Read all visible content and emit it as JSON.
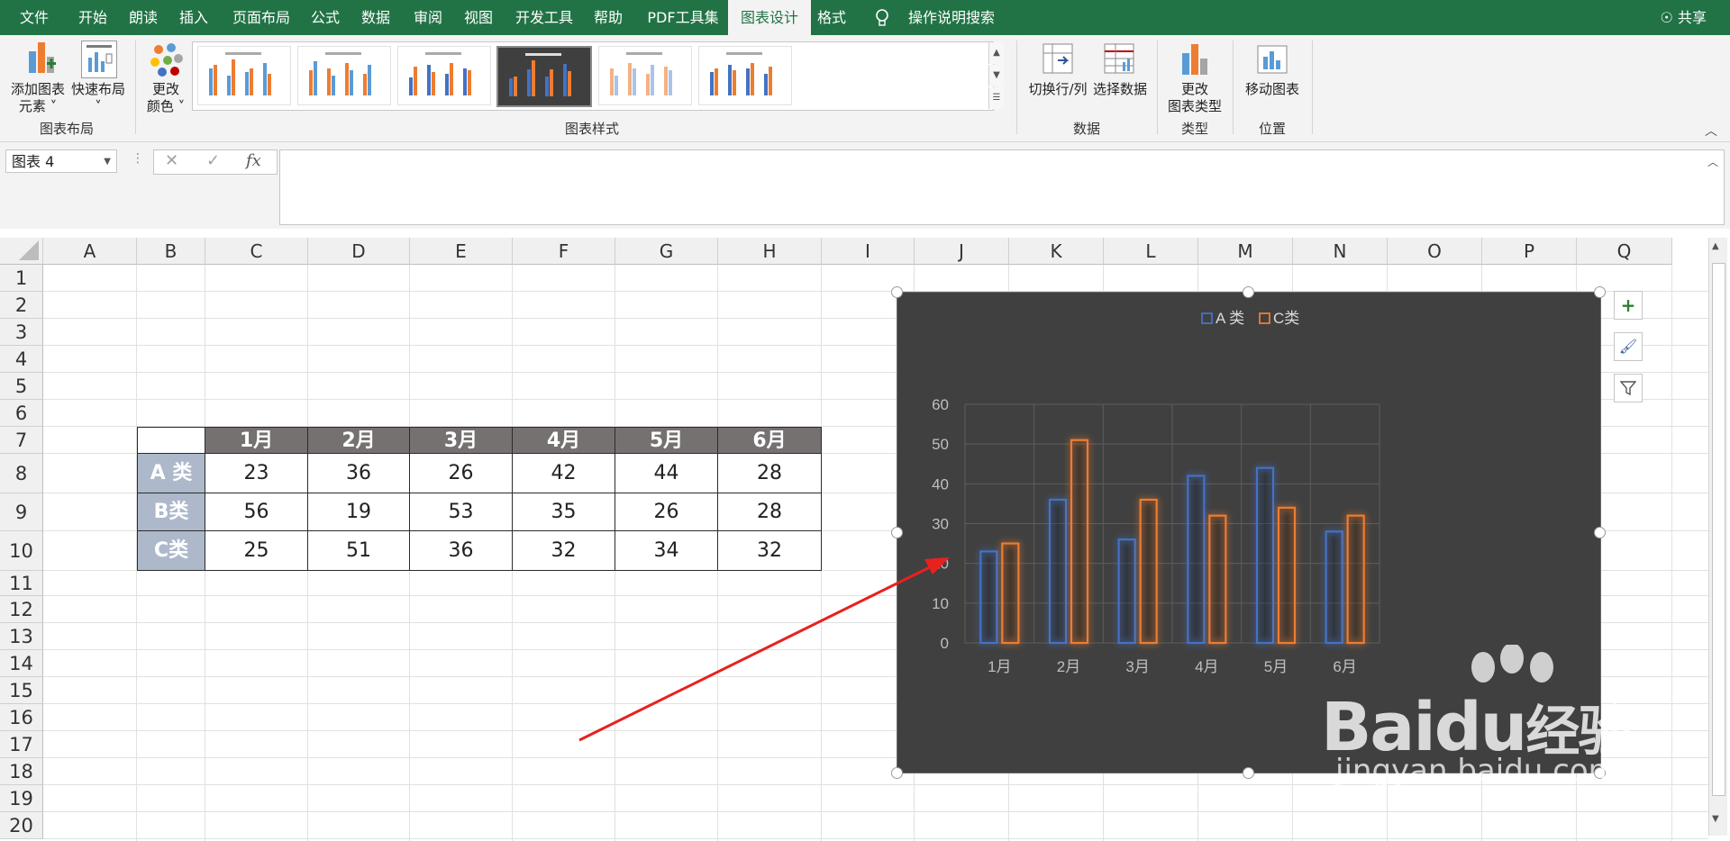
{
  "tabs": [
    "文件",
    "开始",
    "朗读",
    "插入",
    "页面布局",
    "公式",
    "数据",
    "审阅",
    "视图",
    "开发工具",
    "帮助",
    "PDF工具集",
    "图表设计",
    "格式"
  ],
  "tell_me": "操作说明搜索",
  "share": "共享",
  "ribbon": {
    "add_element_line1": "添加图表",
    "add_element_line2": "元素",
    "quick_layout": "快速布局",
    "change_colors_line1": "更改",
    "change_colors_line2": "颜色",
    "group_layout": "图表布局",
    "group_styles": "图表样式",
    "switch_row_col": "切换行/列",
    "select_data": "选择数据",
    "group_data": "数据",
    "change_type_line1": "更改",
    "change_type_line2": "图表类型",
    "group_type": "类型",
    "move_chart": "移动图表",
    "group_location": "位置"
  },
  "namebox": "图表 4",
  "fx": "fx",
  "columns": [
    "A",
    "B",
    "C",
    "D",
    "E",
    "F",
    "G",
    "H",
    "I",
    "J",
    "K",
    "L",
    "M",
    "N",
    "O",
    "P",
    "Q"
  ],
  "rows": [
    "1",
    "2",
    "3",
    "4",
    "5",
    "6",
    "7",
    "8",
    "9",
    "10",
    "11",
    "12",
    "13",
    "14",
    "15",
    "16",
    "17",
    "18",
    "19",
    "20"
  ],
  "table": {
    "headers": [
      "1月",
      "2月",
      "3月",
      "4月",
      "5月",
      "6月"
    ],
    "rows": [
      {
        "label": "A 类",
        "values": [
          "23",
          "36",
          "26",
          "42",
          "44",
          "28"
        ]
      },
      {
        "label": "B类",
        "values": [
          "56",
          "19",
          "53",
          "35",
          "26",
          "28"
        ]
      },
      {
        "label": "C类",
        "values": [
          "25",
          "51",
          "36",
          "32",
          "34",
          "32"
        ]
      }
    ]
  },
  "chart_data": {
    "type": "bar",
    "categories": [
      "1月",
      "2月",
      "3月",
      "4月",
      "5月",
      "6月"
    ],
    "series": [
      {
        "name": "A 类",
        "values": [
          23,
          36,
          26,
          42,
          44,
          28
        ],
        "color": "#4472c4"
      },
      {
        "name": "C类",
        "values": [
          25,
          51,
          36,
          32,
          34,
          32
        ],
        "color": "#ed7d31"
      }
    ],
    "yticks": [
      "0",
      "10",
      "20",
      "30",
      "40",
      "50",
      "60"
    ],
    "ylim": [
      0,
      60
    ],
    "grid": true,
    "legend": "top",
    "background": "#404040"
  },
  "watermark": {
    "brand": "Baidu",
    "cn": "经验",
    "url": "jingyan.baidu.com"
  },
  "colors": {
    "accent": "#217346",
    "arrow": "#e8211f"
  }
}
